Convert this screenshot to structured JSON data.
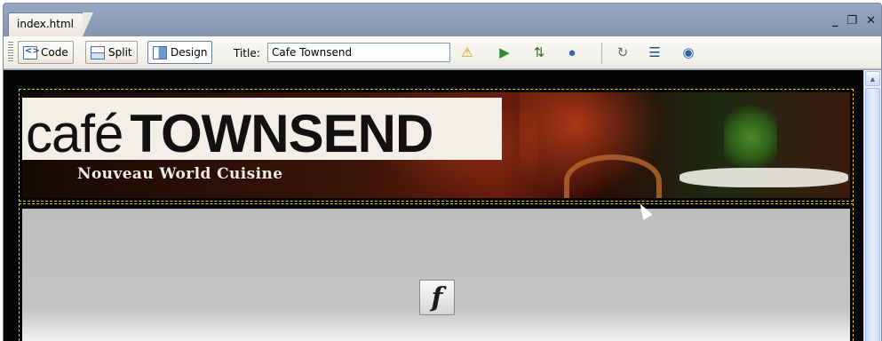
{
  "tab": {
    "label": "index.html"
  },
  "window_controls": {
    "minimize": "_",
    "restore": "❐",
    "close": "✕"
  },
  "toolbar": {
    "code_label": "Code",
    "split_label": "Split",
    "design_label": "Design",
    "title_label": "Title:",
    "title_value": "Cafe Townsend"
  },
  "banner": {
    "logo_cafe": "café",
    "logo_townsend": "TOWNSEND",
    "tagline": "Nouveau World Cuisine"
  },
  "flash": {
    "glyph": "f"
  },
  "colors": {
    "accent": "#6d7fa3",
    "selection_outline": "#e6d300",
    "canvas": "#050505"
  }
}
